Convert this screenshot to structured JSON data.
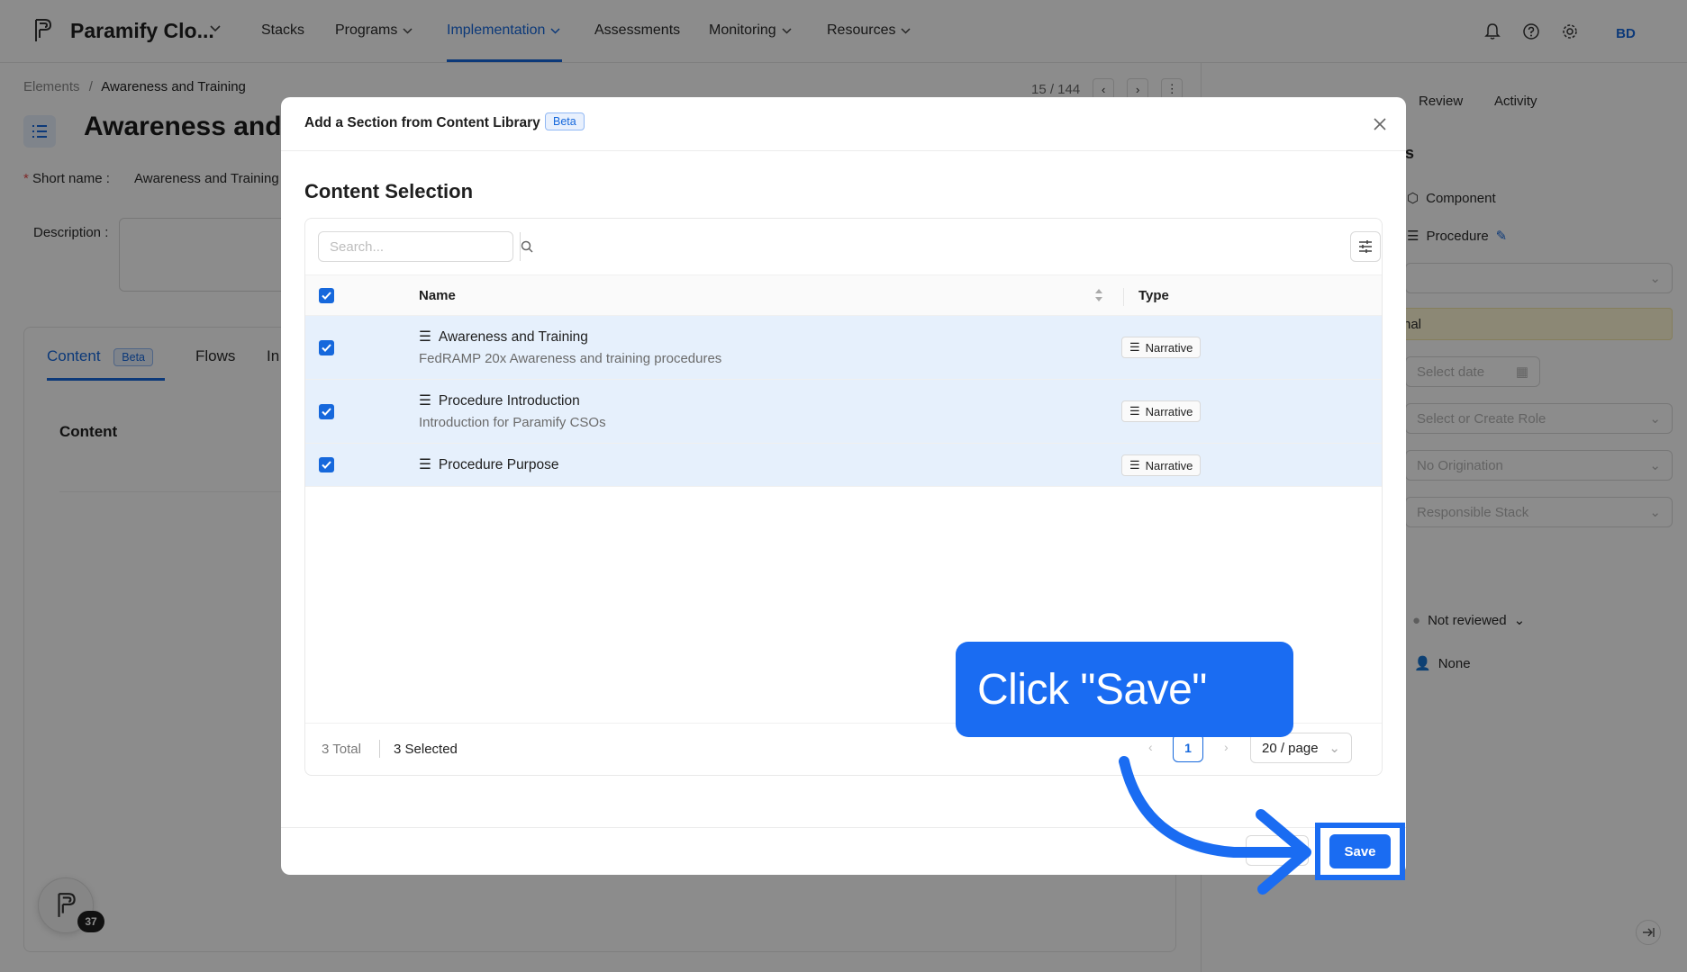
{
  "topnav": {
    "app_name": "Paramify Clo...",
    "items": [
      {
        "label": "Stacks"
      },
      {
        "label": "Programs"
      },
      {
        "label": "Implementation"
      },
      {
        "label": "Assessments"
      },
      {
        "label": "Monitoring"
      },
      {
        "label": "Resources"
      }
    ],
    "avatar": "BD"
  },
  "page": {
    "breadcrumb": {
      "parent": "Elements",
      "sep": "/",
      "current": "Awareness and Training"
    },
    "pager": "15 / 144",
    "title": "Awareness and T",
    "short_name_label": "Short name",
    "short_name_value": "Awareness and Training",
    "description_label": "Description",
    "tabs": [
      {
        "label": "Content"
      },
      {
        "label": "Flows"
      },
      {
        "label": "In"
      }
    ],
    "beta": "Beta",
    "content_heading": "Content"
  },
  "right_panel": {
    "tabs": [
      {
        "label": "Review"
      },
      {
        "label": "Activity"
      }
    ],
    "heading_tail": "s",
    "component": "Component",
    "procedure": "Procedure",
    "yellow_text": "nal",
    "select_date": "Select date",
    "select_role": "Select or Create Role",
    "origination": "No Origination",
    "responsible_stack": "Responsible Stack",
    "review_status": "Not reviewed",
    "assignee": "None"
  },
  "fab": {
    "badge": "37"
  },
  "modal": {
    "title": "Add a Section from Content Library",
    "beta": "Beta",
    "section_title": "Content Selection",
    "search_placeholder": "Search...",
    "columns": {
      "name": "Name",
      "type": "Type"
    },
    "rows": [
      {
        "name": "Awareness and Training",
        "description": "FedRAMP 20x Awareness and training procedures",
        "type": "Narrative",
        "checked": true
      },
      {
        "name": "Procedure Introduction",
        "description": "Introduction for Paramify CSOs",
        "type": "Narrative",
        "checked": true
      },
      {
        "name": "Procedure Purpose",
        "description": "",
        "type": "Narrative",
        "checked": true
      }
    ],
    "footer": {
      "total": "3 Total",
      "selected": "3 Selected",
      "page": "1",
      "per_page": "20 / page"
    },
    "save_label": "Save"
  },
  "callout": {
    "text": "Click \"Save\""
  },
  "colors": {
    "accent": "#1668dc",
    "callout": "#1a6cf2",
    "row_selected": "#e6f0fc"
  }
}
